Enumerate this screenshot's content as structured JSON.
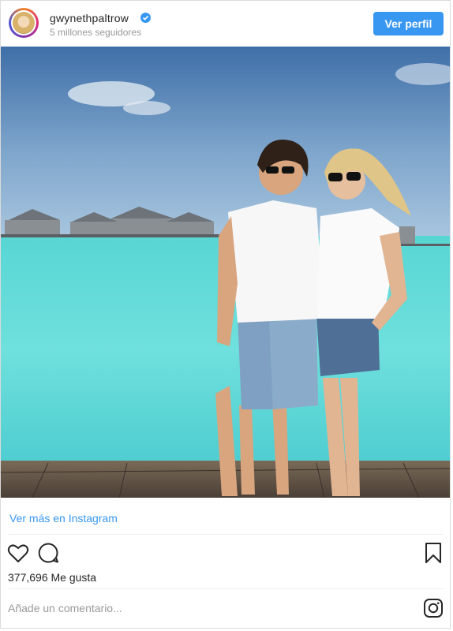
{
  "header": {
    "username": "gwynethpaltrow",
    "followers": "5 millones seguidores",
    "profile_button": "Ver perfil"
  },
  "post": {
    "view_more_link": "Ver más en Instagram",
    "likes": "377,696 Me gusta",
    "comment_placeholder": "Añade un comentario..."
  },
  "icons": {
    "like": "heart-icon",
    "comment": "comment-icon",
    "save": "bookmark-icon",
    "brand": "instagram-icon",
    "verified": "verified-badge-icon"
  },
  "colors": {
    "accent": "#3897f0",
    "text": "#262626",
    "muted": "#999999",
    "border": "#dbdbdb"
  }
}
